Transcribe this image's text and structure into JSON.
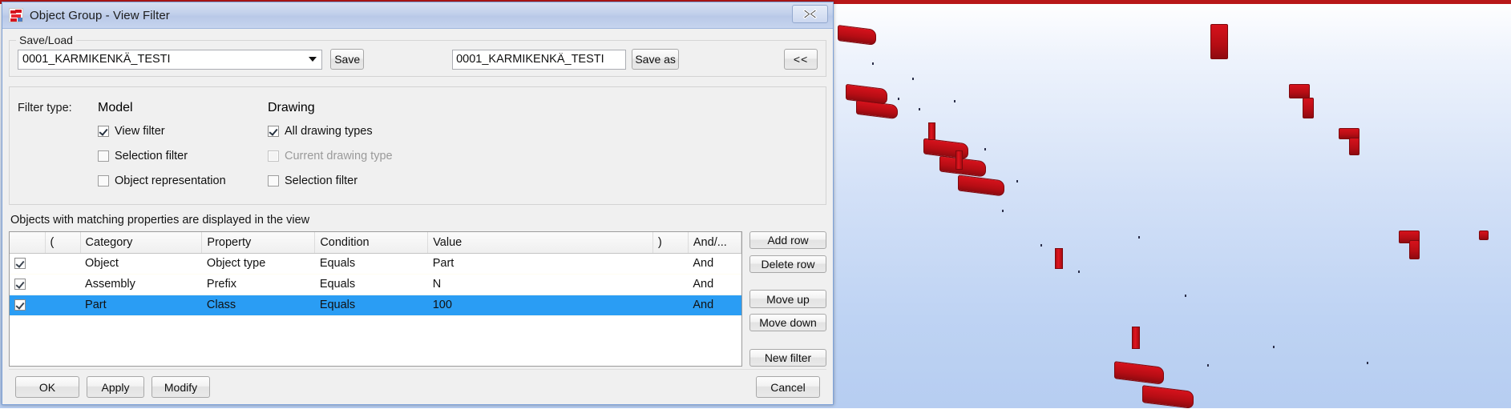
{
  "window": {
    "title": "Object Group - View Filter",
    "icon": "tekla-app-icon",
    "close_label": "close-icon"
  },
  "saveload": {
    "group_title": "Save/Load",
    "combo_value": "0001_KARMIKENKÄ_TESTI",
    "combo_arrow": "chevron-down-icon",
    "save_label": "Save",
    "savename_value": "0001_KARMIKENKÄ_TESTI",
    "savename_placeholder": "",
    "saveas_label": "Save as",
    "collapse_label": "<<"
  },
  "filter_type": {
    "label": "Filter type:",
    "model_header": "Model",
    "drawing_header": "Drawing",
    "model_options": [
      {
        "label": "View filter",
        "checked": true,
        "enabled": true
      },
      {
        "label": "Selection filter",
        "checked": false,
        "enabled": true
      },
      {
        "label": "Object representation",
        "checked": false,
        "enabled": true
      }
    ],
    "drawing_options": [
      {
        "label": "All drawing types",
        "checked": true,
        "enabled": true
      },
      {
        "label": "Current drawing type",
        "checked": false,
        "enabled": false
      },
      {
        "label": "Selection filter",
        "checked": false,
        "enabled": true
      }
    ]
  },
  "description": "Objects with matching properties are displayed in the view",
  "grid": {
    "columns": [
      "",
      "(",
      "Category",
      "Property",
      "Condition",
      "Value",
      ")",
      "And/..."
    ],
    "rows": [
      {
        "checked": true,
        "open_paren": "",
        "category": "Object",
        "property": "Object type",
        "condition": "Equals",
        "value": "Part",
        "close_paren": "",
        "conjunction": "And",
        "selected": false
      },
      {
        "checked": true,
        "open_paren": "",
        "category": "Assembly",
        "property": "Prefix",
        "condition": "Equals",
        "value": "N",
        "close_paren": "",
        "conjunction": "And",
        "selected": false
      },
      {
        "checked": true,
        "open_paren": "",
        "category": "Part",
        "property": "Class",
        "condition": "Equals",
        "value": "100",
        "close_paren": "",
        "conjunction": "And",
        "selected": true
      }
    ],
    "selection_color": "#2a9df4"
  },
  "side_buttons": {
    "add_row": "Add row",
    "delete_row": "Delete row",
    "move_up": "Move up",
    "move_down": "Move down",
    "new_filter": "New filter"
  },
  "footer": {
    "ok": "OK",
    "apply": "Apply",
    "modify": "Modify",
    "cancel": "Cancel"
  },
  "viewport": {
    "background_top": "#ffffff",
    "background_bottom": "#b6cdf1",
    "object_color": "#c01018",
    "top_border_color": "#b81718"
  }
}
